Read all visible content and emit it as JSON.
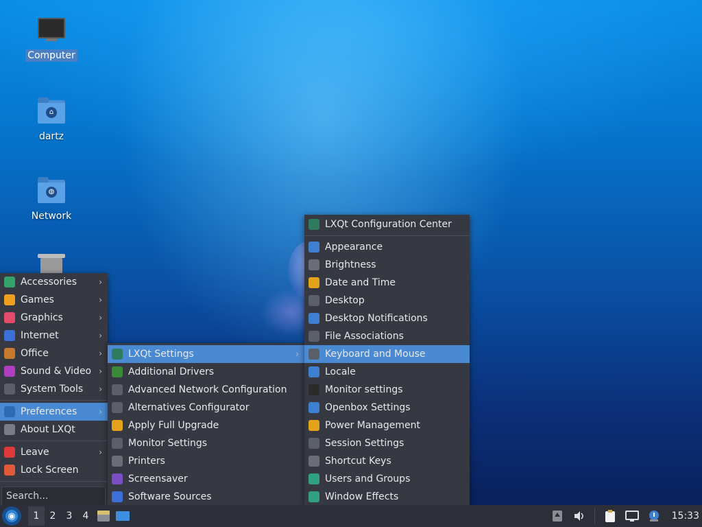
{
  "desktop": {
    "icons": [
      {
        "label": "Computer",
        "icon": "computer-icon"
      },
      {
        "label": "dartz",
        "icon": "home-folder-icon"
      },
      {
        "label": "Network",
        "icon": "network-folder-icon"
      },
      {
        "label": "",
        "icon": "trash-icon"
      }
    ]
  },
  "main_menu": {
    "items": [
      {
        "label": "Accessories",
        "icon": "accessories-icon",
        "color": "#35a26b",
        "submenu": true
      },
      {
        "label": "Games",
        "icon": "games-icon",
        "color": "#f0a020",
        "submenu": true
      },
      {
        "label": "Graphics",
        "icon": "graphics-icon",
        "color": "#e34b6a",
        "submenu": true
      },
      {
        "label": "Internet",
        "icon": "internet-icon",
        "color": "#3d6fd8",
        "submenu": true
      },
      {
        "label": "Office",
        "icon": "office-icon",
        "color": "#c67a2e",
        "submenu": true
      },
      {
        "label": "Sound & Video",
        "icon": "sound-video-icon",
        "color": "#b03ec0",
        "submenu": true
      },
      {
        "label": "System Tools",
        "icon": "system-tools-icon",
        "color": "#5a5f6a",
        "submenu": true
      },
      {
        "label": "Preferences",
        "icon": "preferences-icon",
        "color": "#2d6bb4",
        "submenu": true,
        "active": true
      },
      {
        "label": "About LXQt",
        "icon": "about-icon",
        "color": "#7a7d86",
        "submenu": false
      },
      {
        "label": "Leave",
        "icon": "leave-icon",
        "color": "#e0393b",
        "submenu": true
      },
      {
        "label": "Lock Screen",
        "icon": "lock-icon",
        "color": "#e05a3b",
        "submenu": false
      }
    ],
    "search_placeholder": "Search..."
  },
  "preferences_menu": {
    "items": [
      {
        "label": "LXQt Settings",
        "icon": "lxqt-settings-icon",
        "color": "#2f7b5f",
        "submenu": true,
        "active": true
      },
      {
        "label": "Additional Drivers",
        "icon": "drivers-icon",
        "color": "#3a8a3a"
      },
      {
        "label": "Advanced Network Configuration",
        "icon": "network-config-icon",
        "color": "#5a5f6a"
      },
      {
        "label": "Alternatives Configurator",
        "icon": "alternatives-icon",
        "color": "#5a5f6a"
      },
      {
        "label": "Apply Full Upgrade",
        "icon": "upgrade-icon",
        "color": "#e2a21a"
      },
      {
        "label": "Monitor Settings",
        "icon": "monitor-icon",
        "color": "#5a5f6a"
      },
      {
        "label": "Printers",
        "icon": "printer-icon",
        "color": "#6a6d76"
      },
      {
        "label": "Screensaver",
        "icon": "screensaver-icon",
        "color": "#7a4fc4"
      },
      {
        "label": "Software Sources",
        "icon": "software-sources-icon",
        "color": "#3d6fd8"
      }
    ]
  },
  "lxqt_settings_menu": {
    "header": {
      "label": "LXQt Configuration Center",
      "icon": "config-center-icon",
      "color": "#2f7b5f"
    },
    "items": [
      {
        "label": "Appearance",
        "icon": "appearance-icon",
        "color": "#3d7fd0"
      },
      {
        "label": "Brightness",
        "icon": "brightness-icon",
        "color": "#6a6d76"
      },
      {
        "label": "Date and Time",
        "icon": "clock-icon",
        "color": "#e2a21a"
      },
      {
        "label": "Desktop",
        "icon": "desktop-icon",
        "color": "#5a5f6a"
      },
      {
        "label": "Desktop Notifications",
        "icon": "notifications-icon",
        "color": "#3d7fd0"
      },
      {
        "label": "File Associations",
        "icon": "file-associations-icon",
        "color": "#5a5f6a"
      },
      {
        "label": "Keyboard and Mouse",
        "icon": "mouse-icon",
        "color": "#5a5f6a",
        "active": true
      },
      {
        "label": "Locale",
        "icon": "locale-icon",
        "color": "#3d7fd0"
      },
      {
        "label": "Monitor settings",
        "icon": "monitor-settings-icon",
        "color": "#2b2b2b"
      },
      {
        "label": "Openbox Settings",
        "icon": "openbox-icon",
        "color": "#3d7fd0"
      },
      {
        "label": "Power Management",
        "icon": "power-icon",
        "color": "#e2a21a"
      },
      {
        "label": "Session Settings",
        "icon": "session-icon",
        "color": "#5a5f6a"
      },
      {
        "label": "Shortcut Keys",
        "icon": "keyboard-icon",
        "color": "#6a6d76"
      },
      {
        "label": "Users and Groups",
        "icon": "users-icon",
        "color": "#2fa080"
      },
      {
        "label": "Window Effects",
        "icon": "window-effects-icon",
        "color": "#2fa080"
      }
    ]
  },
  "taskbar": {
    "desktops": [
      "1",
      "2",
      "3",
      "4"
    ],
    "current_desktop": "1",
    "clock": "15:33"
  }
}
